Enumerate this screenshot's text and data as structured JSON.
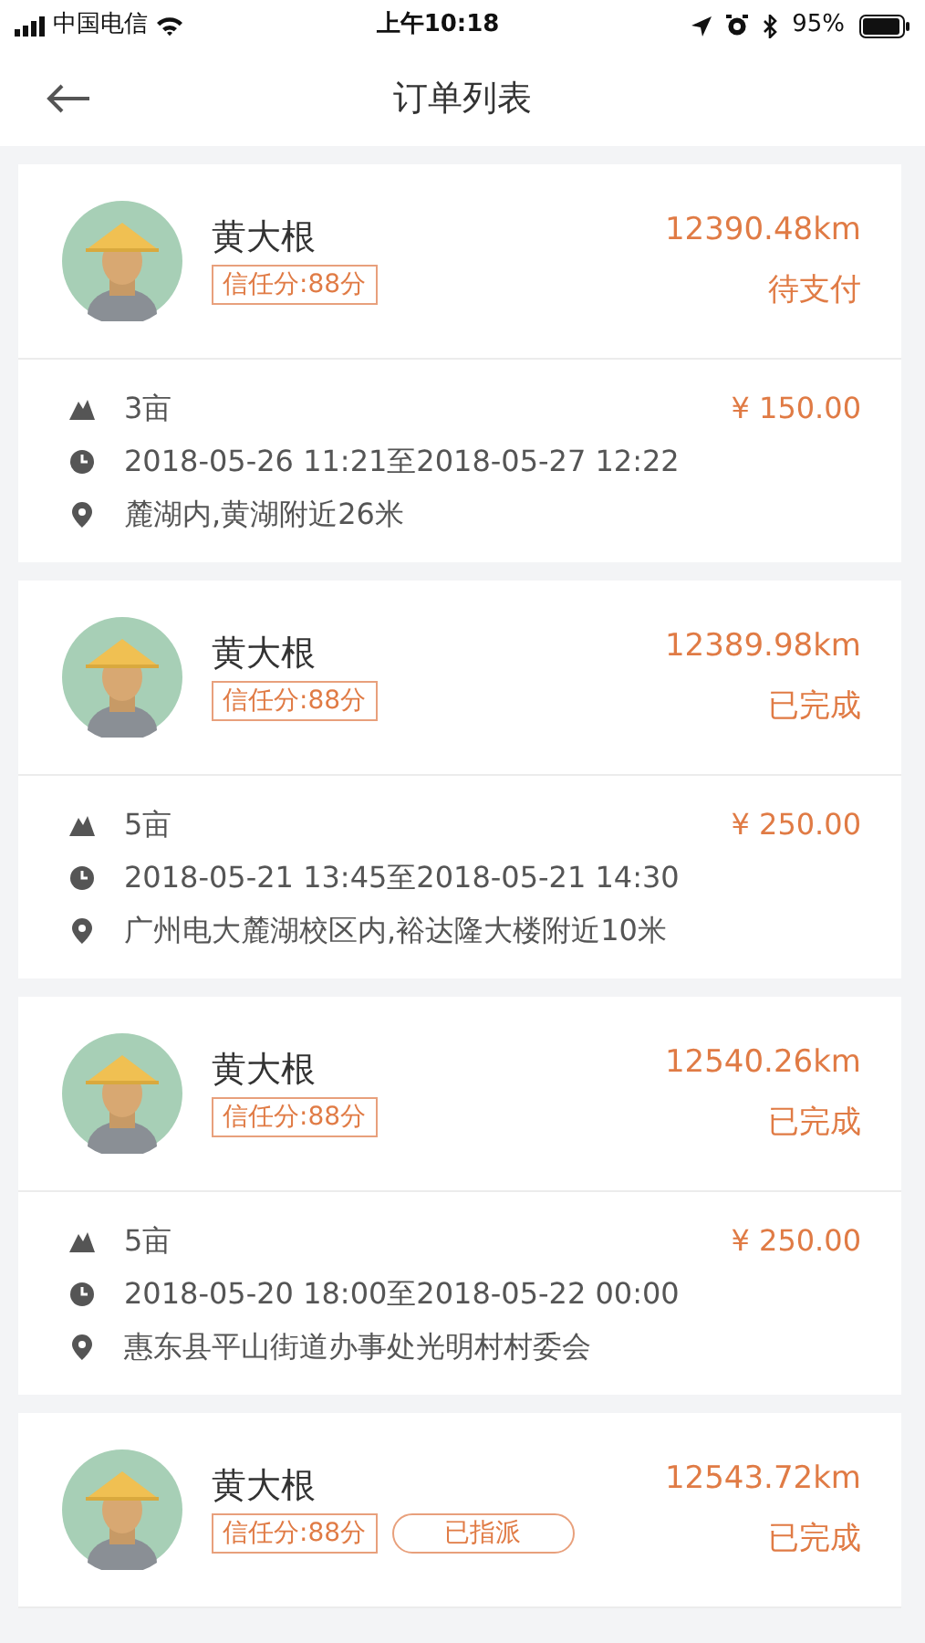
{
  "status_bar": {
    "carrier": "中国电信",
    "time": "上午10:18",
    "battery": "95%"
  },
  "nav": {
    "title": "订单列表"
  },
  "orders": [
    {
      "name": "黄大根",
      "trust_score": "信任分:88分",
      "distance": "12390.48km",
      "status": "待支付",
      "area": "3亩",
      "price": "¥ 150.00",
      "time_range": "2018-05-26 11:21至2018-05-27 12:22",
      "location": "麓湖内,黄湖附近26米"
    },
    {
      "name": "黄大根",
      "trust_score": "信任分:88分",
      "distance": "12389.98km",
      "status": "已完成",
      "area": "5亩",
      "price": "¥ 250.00",
      "time_range": "2018-05-21 13:45至2018-05-21 14:30",
      "location": "广州电大麓湖校区内,裕达隆大楼附近10米"
    },
    {
      "name": "黄大根",
      "trust_score": "信任分:88分",
      "distance": "12540.26km",
      "status": "已完成",
      "area": "5亩",
      "price": "¥ 250.00",
      "time_range": "2018-05-20 18:00至2018-05-22 00:00",
      "location": "惠东县平山街道办事处光明村村委会"
    },
    {
      "name": "黄大根",
      "trust_score": "信任分:88分",
      "tag": "已指派",
      "distance": "12543.72km",
      "status": "已完成"
    }
  ]
}
